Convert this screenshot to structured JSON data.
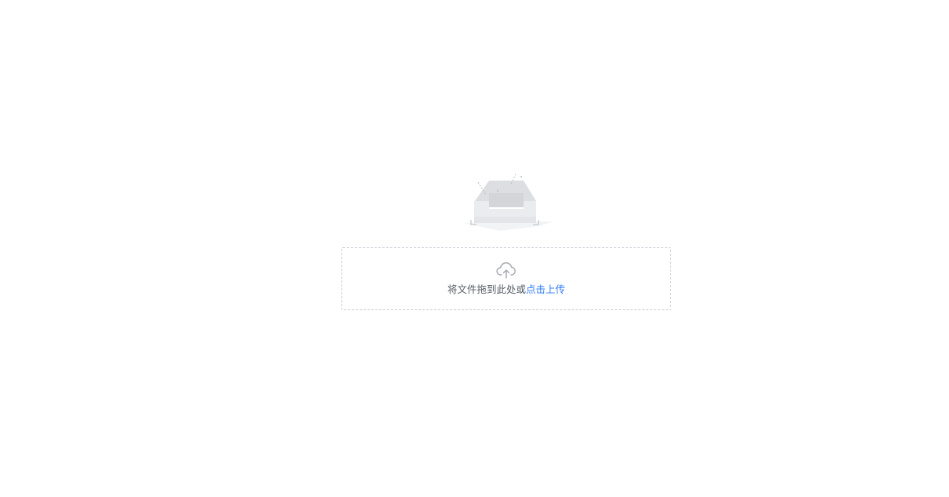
{
  "empty_state": {
    "illustration": "empty-inbox-icon"
  },
  "upload": {
    "icon": "cloud-upload-icon",
    "prompt_text": "将文件拖到此处或",
    "link_text": "点击上传",
    "link_color": "#2f7cf6",
    "text_color": "#555a63",
    "border_color": "#c8ccd4"
  }
}
